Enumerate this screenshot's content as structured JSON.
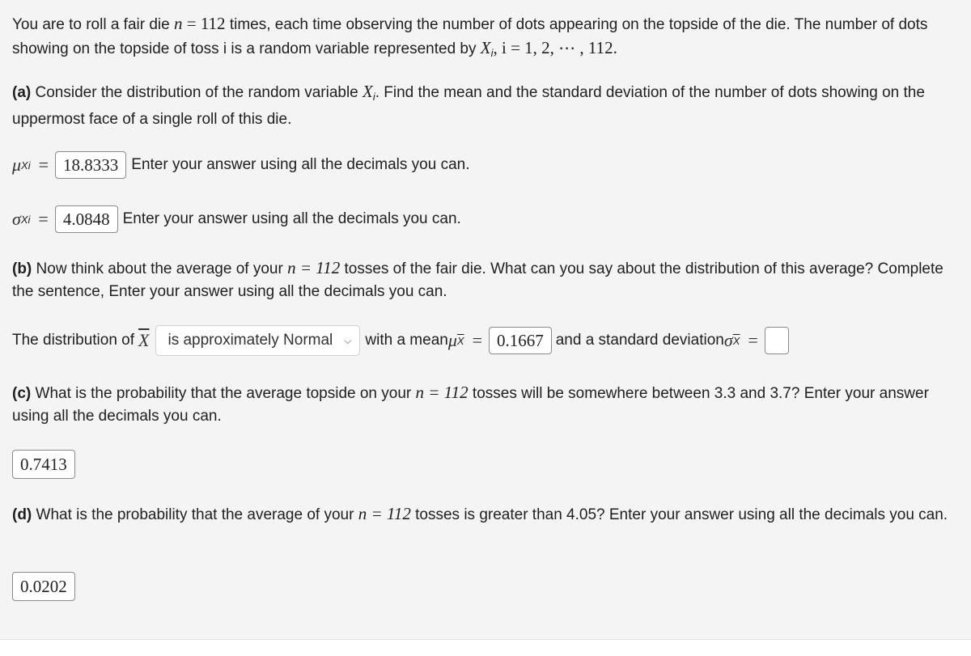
{
  "intro": {
    "text1": "You are to roll a fair die ",
    "n_sym": "n",
    "n_eq": " = 112",
    "text2": " times, each time observing the number of dots appearing on the topside of the die. The number of dots showing on the topside of toss i is a random variable represented by ",
    "xi": "X",
    "xi_sub": "i",
    "range": ", i = 1, 2, ⋯ , 112."
  },
  "part_a": {
    "label": "(a)",
    "text1": " Consider the distribution of the random variable ",
    "xi": "X",
    "xi_sub": "i",
    "text2": ". Find the mean and the standard deviation of the number of dots showing on the uppermost face of a single roll of this die.",
    "mean_symbol": "μ",
    "mean_sub": "Xi",
    "mean_value": "18.8333",
    "sd_symbol": "σ",
    "sd_sub": "Xi",
    "sd_value": "4.0848",
    "equals": "=",
    "hint": "Enter your answer using all the decimals you can."
  },
  "part_b": {
    "label": "(b)",
    "text1": " Now think about the average of your ",
    "n_expr": "n = 112",
    "text2": " tosses of the fair die. What can you say about the distribution of this average? Complete the sentence, Enter your answer using all the decimals you can.",
    "sentence_start": "The distribution of ",
    "xbar": "X",
    "select_value": "is approximately Normal",
    "with_mean": "with a mean ",
    "mean_symbol": "μ",
    "mean_sub": "X",
    "mean_value": "0.1667",
    "and_sd": "and a standard deviation ",
    "sd_symbol": "σ",
    "sd_sub": "X",
    "sd_value": "",
    "equals": "="
  },
  "part_c": {
    "label": "(c)",
    "text1": " What is the probability that the average topside on your ",
    "n_expr": "n = 112",
    "text2": " tosses will be somewhere between 3.3 and 3.7? Enter your answer using all the decimals you can.",
    "answer": "0.7413"
  },
  "part_d": {
    "label": "(d)",
    "text1": " What is the probability that the average of your ",
    "n_expr": "n = 112",
    "text2": " tosses is greater than 4.05? Enter your answer using all the decimals you can.",
    "answer": "0.0202"
  }
}
